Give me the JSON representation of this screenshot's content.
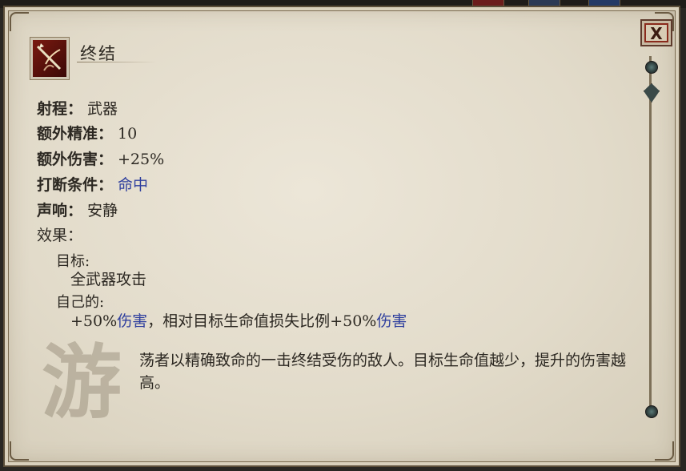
{
  "window": {
    "close_label": "X"
  },
  "ability": {
    "title": "终结",
    "icon": "slash-strike-icon"
  },
  "stats": [
    {
      "label": "射程：",
      "value": "武器",
      "value_color": "default"
    },
    {
      "label": "额外精准：",
      "value": "10",
      "value_color": "default"
    },
    {
      "label": "额外伤害：",
      "value": "+25%",
      "value_color": "default"
    },
    {
      "label": "打断条件：",
      "value": "命中",
      "value_color": "blue"
    },
    {
      "label": "声响：",
      "value": "安静",
      "value_color": "default"
    }
  ],
  "effects": {
    "label": "效果：",
    "target_label": "目标:",
    "target_value": "全武器攻击",
    "self_label": "自己的:",
    "self_parts": [
      "+50%",
      "伤害",
      "，相对目标生命值损失比例",
      "+50%",
      "伤害"
    ]
  },
  "class_watermark": "游",
  "description": "荡者以精确致命的一击终结受伤的敌人。目标生命值越少，提升的伤害越高。",
  "colors": {
    "link_blue": "#2f3f9e",
    "parchment": "#e6dfcf",
    "frame": "#5d4f3a"
  }
}
